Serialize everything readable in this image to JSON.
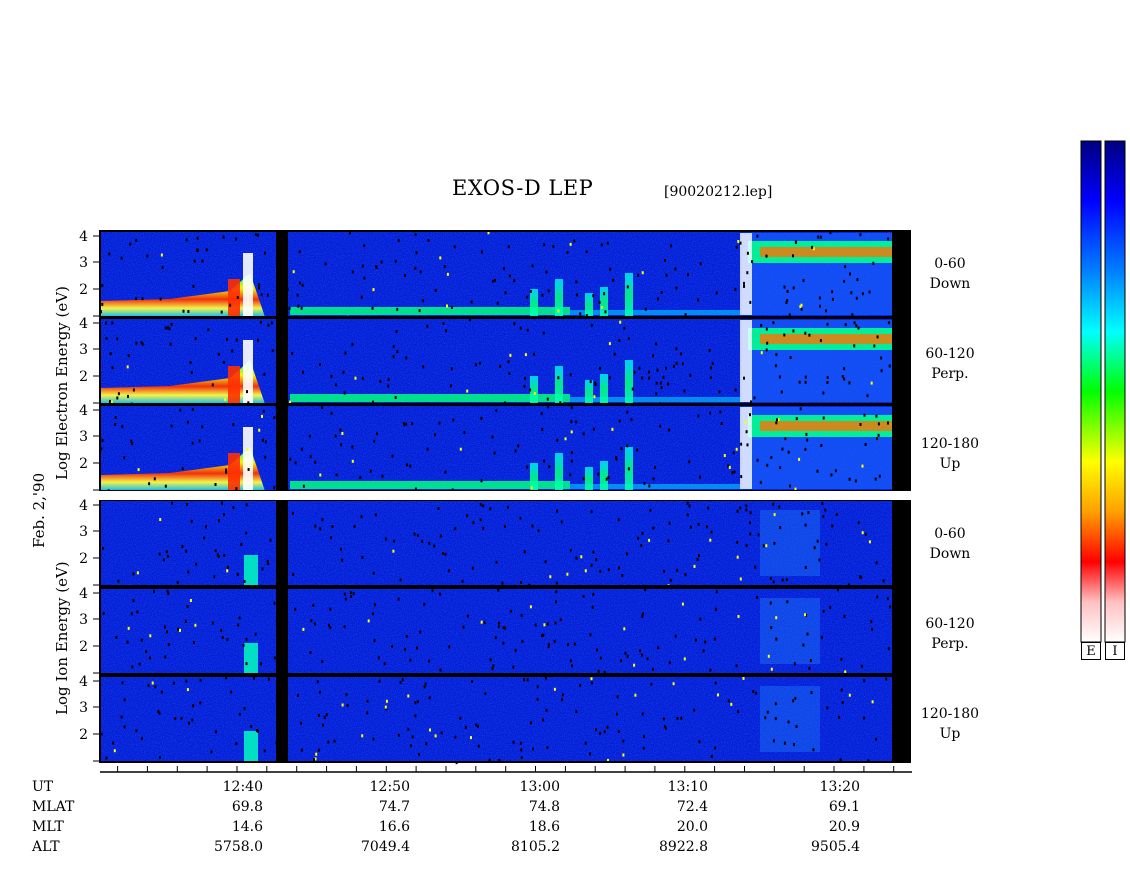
{
  "header": {
    "title": "EXOS-D LEP",
    "file": "[90020212.lep]"
  },
  "y_labels": {
    "electron": "Log   Electron   Energy (eV)",
    "ion": "Log   Ion   Energy (eV)",
    "date": "Feb. 2,'90"
  },
  "panels": [
    {
      "angle": "0-60",
      "direction": "Down"
    },
    {
      "angle": "60-120",
      "direction": "Perp."
    },
    {
      "angle": "120-180",
      "direction": "Up"
    },
    {
      "angle": "0-60",
      "direction": "Down"
    },
    {
      "angle": "60-120",
      "direction": "Perp."
    },
    {
      "angle": "120-180",
      "direction": "Up"
    }
  ],
  "y_ticks": [
    "4",
    "3",
    "2"
  ],
  "colorbar": {
    "letters": [
      "E",
      "I"
    ],
    "colors": [
      "#ffffff",
      "#ffc0c0",
      "#ff0000",
      "#ffa000",
      "#ffff00",
      "#00ff00",
      "#00ffff",
      "#0080ff",
      "#0000ff",
      "#000080"
    ]
  },
  "ephemeris": {
    "row_labels": [
      "UT",
      "MLAT",
      "MLT",
      "ALT"
    ],
    "columns": [
      {
        "UT": "12:40",
        "MLAT": "69.8",
        "MLT": "14.6",
        "ALT": "5758.0"
      },
      {
        "UT": "12:50",
        "MLAT": "74.7",
        "MLT": "16.6",
        "ALT": "7049.4"
      },
      {
        "UT": "13:00",
        "MLAT": "74.8",
        "MLT": "18.6",
        "ALT": "8105.2"
      },
      {
        "UT": "13:10",
        "MLAT": "72.4",
        "MLT": "20.0",
        "ALT": "8922.8"
      },
      {
        "UT": "13:20",
        "MLAT": "69.1",
        "MLT": "20.9",
        "ALT": "9505.4"
      }
    ]
  },
  "chart_data": {
    "type": "heatmap",
    "title": "EXOS-D LEP",
    "x_label": "UT",
    "x_ticks": [
      "12:40",
      "12:50",
      "13:00",
      "13:10",
      "13:20"
    ],
    "y_ticks": [
      4,
      3,
      2
    ],
    "y_scale": "log",
    "grid": false,
    "panels": [
      "0-60 Down",
      "60-120 Perp.",
      "120-180 Up",
      "0-60 Down",
      "60-120 Perp.",
      "120-180 Up"
    ]
  }
}
